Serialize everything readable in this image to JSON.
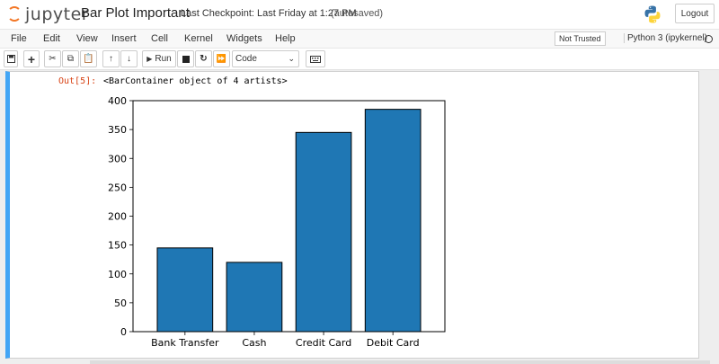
{
  "header": {
    "logo_text": "jupyter",
    "notebook_title": "Bar Plot Important",
    "checkpoint": "Last Checkpoint: Last Friday at 1:27 PM",
    "autosave": "(autosaved)",
    "logout_label": "Logout"
  },
  "menubar": {
    "items": [
      "File",
      "Edit",
      "View",
      "Insert",
      "Cell",
      "Kernel",
      "Widgets",
      "Help"
    ],
    "trust_label": "Not Trusted",
    "kernel_name": "Python 3 (ipykernel)"
  },
  "toolbar": {
    "run_label": "Run",
    "cell_type": "Code"
  },
  "output": {
    "prompt": "Out[5]:",
    "text": "<BarContainer object of 4 artists>"
  },
  "chart_data": {
    "type": "bar",
    "categories": [
      "Bank Transfer",
      "Cash",
      "Credit Card",
      "Debit Card"
    ],
    "values": [
      145,
      120,
      345,
      385
    ],
    "ylim": [
      0,
      400
    ],
    "yticks": [
      0,
      50,
      100,
      150,
      200,
      250,
      300,
      350,
      400
    ],
    "bar_color": "#1f77b4",
    "edge_color": "#000000",
    "title": "",
    "xlabel": "",
    "ylabel": ""
  }
}
